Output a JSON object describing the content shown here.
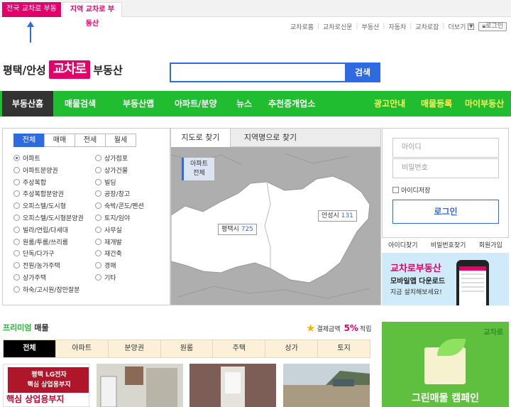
{
  "top_tabs": {
    "national": "전국 교차로 부동산",
    "regional": "지역 교차로 부동산"
  },
  "util_links": [
    "교차로홈",
    "교차로신문",
    "부동산",
    "자동차",
    "교차로잡"
  ],
  "util_more": "더보기",
  "util_login": "로그인",
  "logo": {
    "region": "평택/안성",
    "brand": "교차로",
    "suffix": "부동산"
  },
  "search": {
    "placeholder": "",
    "button": "검색"
  },
  "nav": {
    "home": "부동산홈",
    "items": [
      "매물검색",
      "부동산맵",
      "아파트/분양",
      "뉴스",
      "추천중개업소"
    ],
    "right_items": [
      "광고안내",
      "매물등록",
      "마이부동산"
    ]
  },
  "deal_tabs": [
    "전체",
    "매매",
    "전세",
    "월세"
  ],
  "property_types_left": [
    "아파트",
    "아파트분양권",
    "주상복합",
    "주상복합분양권",
    "오피스텔/도시형",
    "오피스텔/도시형분양권",
    "빌라/연립/다세대",
    "원룸/투룸/쓰리룸",
    "단독/다가구",
    "전원/농가주택",
    "상가주택",
    "하숙/고시원/잠만잘분"
  ],
  "property_types_right": [
    "상가점포",
    "상가건물",
    "빌딩",
    "공장/창고",
    "숙박/콘도/펜션",
    "토지/임야",
    "사무실",
    "재개발",
    "재건축",
    "경매",
    "기타"
  ],
  "map": {
    "tab_map": "지도로 찾기",
    "tab_region": "지역명으로 찾기",
    "badge_line1": "아파트",
    "badge_line2": "전체",
    "pyeongtaek": {
      "name": "평택시",
      "count": "725"
    },
    "anseong": {
      "name": "안성시",
      "count": "131"
    }
  },
  "login": {
    "id_placeholder": "아이디",
    "pw_placeholder": "비밀번호",
    "save_id": "아이디저장",
    "button": "로그인",
    "links": [
      "아이디찾기",
      "비밀번호찾기",
      "회원가입"
    ]
  },
  "app_banner": {
    "title": "교차로부동산",
    "subtitle": "모바일앱 다운로드",
    "cta": "지금 설치해보세요!"
  },
  "premium": {
    "title_green": "프리미엄",
    "title_black": "매물",
    "reward_label": "결제금액",
    "reward_pct": "5%",
    "reward_suffix": "적립",
    "tabs": [
      "전체",
      "아파트",
      "분양권",
      "원룸",
      "주택",
      "상가",
      "토지"
    ]
  },
  "listing1": {
    "line1": "평택 LG전자",
    "line2": "핵심 상업용부지",
    "big": "핵심 상업용부지"
  },
  "ad_banner": {
    "logo": "교차로",
    "caption": "그린매물 캠페인"
  },
  "colors": {
    "brand_pink": "#e2006a",
    "nav_green": "#1fbd2f",
    "search_blue": "#2f6be0"
  }
}
